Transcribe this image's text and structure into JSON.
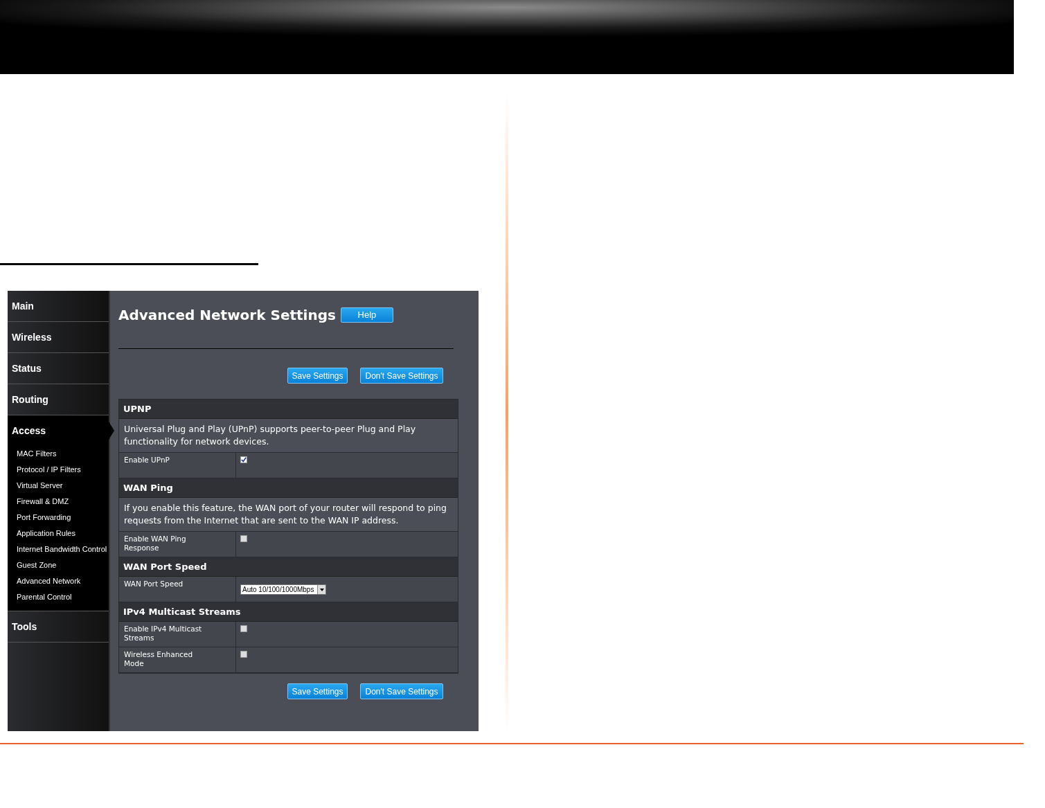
{
  "sidebar": {
    "items": [
      {
        "label": "Main",
        "selected": false
      },
      {
        "label": "Wireless",
        "selected": false
      },
      {
        "label": "Status",
        "selected": false
      },
      {
        "label": "Routing",
        "selected": false
      },
      {
        "label": "Access",
        "selected": true,
        "expanded": true,
        "children": [
          {
            "label": "MAC Filters"
          },
          {
            "label": "Protocol / IP Filters"
          },
          {
            "label": "Virtual Server"
          },
          {
            "label": "Firewall & DMZ"
          },
          {
            "label": "Port Forwarding"
          },
          {
            "label": "Application Rules"
          },
          {
            "label": "Internet Bandwidth Control"
          },
          {
            "label": "Guest Zone"
          },
          {
            "label": "Advanced Network"
          },
          {
            "label": "Parental Control"
          }
        ]
      },
      {
        "label": "Tools",
        "selected": false
      }
    ]
  },
  "page": {
    "title": "Advanced Network Settings",
    "help_button": "Help"
  },
  "top_buttons": [
    "Save Settings",
    "Don't Save Settings"
  ],
  "sections": [
    {
      "title": "UPNP",
      "description": "Universal Plug and Play (UPnP) supports peer-to-peer Plug and Play functionality for network devices.",
      "rows": [
        {
          "label": "Enable UPnP",
          "kind": "checkbox",
          "checked": true
        }
      ]
    },
    {
      "title": "WAN Ping",
      "description": "If you enable this feature, the WAN port of your router will respond to ping requests from the Internet that are sent to the WAN IP address.",
      "rows": [
        {
          "label": "Enable WAN Ping Response",
          "kind": "checkbox",
          "checked": false
        }
      ]
    },
    {
      "title": "WAN Port Speed",
      "rows": [
        {
          "label": "WAN Port Speed",
          "kind": "select",
          "value": "Auto 10/100/1000Mbps"
        }
      ]
    },
    {
      "title": "IPv4 Multicast Streams",
      "rows": [
        {
          "label": "Enable IPv4 Multicast Streams",
          "kind": "checkbox",
          "checked": false
        },
        {
          "label": "Wireless Enhanced Mode",
          "kind": "checkbox",
          "checked": false
        }
      ]
    }
  ],
  "bottom_buttons": [
    "Save Settings",
    "Don't Save Settings"
  ]
}
